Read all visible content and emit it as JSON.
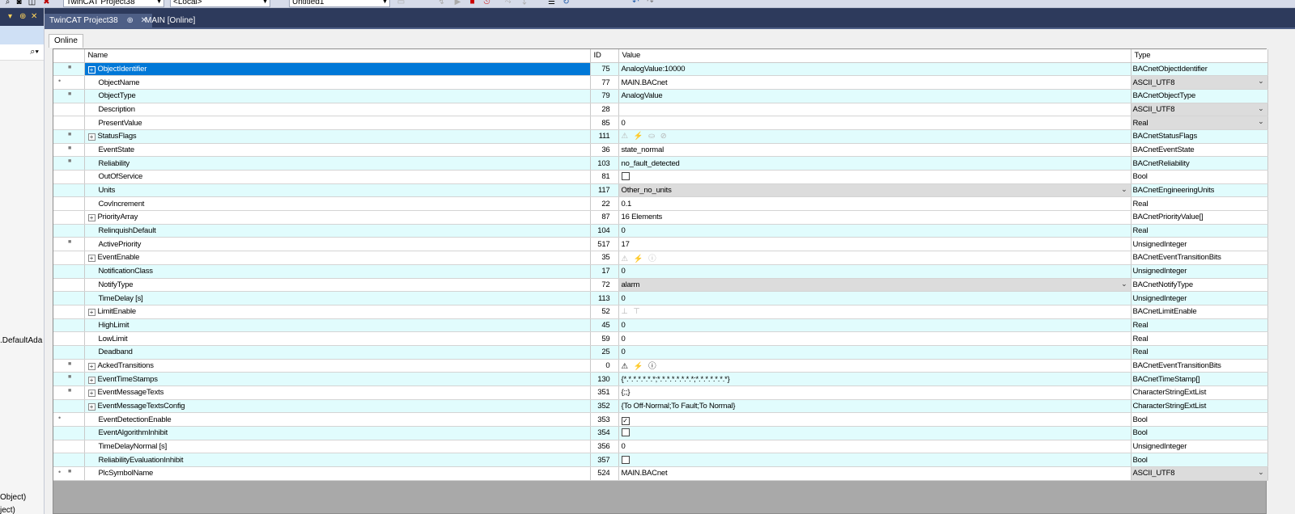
{
  "toolbar": {
    "project_combo": "TwinCAT Project38",
    "target_combo": "<Local>",
    "config_combo": "Untitled1"
  },
  "left_pane": {
    "texts": [
      ".DefaultAda",
      "Object)",
      "ject)"
    ]
  },
  "tabs": [
    {
      "label": "TwinCAT Project38",
      "active": true
    },
    {
      "label": "MAIN [Online]",
      "active": false
    }
  ],
  "inner_tab": "Online",
  "columns": {
    "name": "Name",
    "id": "ID",
    "value": "Value",
    "type": "Type"
  },
  "rows": [
    {
      "name": "ObjectIdentifier",
      "id": "75",
      "value": "AnalogValue:10000",
      "type": "BACnetObjectIdentifier",
      "icons": "lock",
      "expand": true,
      "selected": true
    },
    {
      "name": "ObjectName",
      "id": "77",
      "value": "MAIN.BACnet",
      "type": "ASCII_UTF8",
      "icons": "dot",
      "type_dropdown": true
    },
    {
      "name": "ObjectType",
      "id": "79",
      "value": "AnalogValue",
      "type": "BACnetObjectType",
      "icons": "lock"
    },
    {
      "name": "Description",
      "id": "28",
      "value": "",
      "type": "ASCII_UTF8",
      "type_dropdown": true
    },
    {
      "name": "PresentValue",
      "id": "85",
      "value": "0",
      "type": "Real",
      "type_dropdown": true
    },
    {
      "name": "StatusFlags",
      "id": "111",
      "value": "⚠ ⚡ ⛀ ⊘",
      "value_style": "faint",
      "type": "BACnetStatusFlags",
      "icons": "lock",
      "expand": true
    },
    {
      "name": "EventState",
      "id": "36",
      "value": "state_normal",
      "type": "BACnetEventState",
      "icons": "lock"
    },
    {
      "name": "Reliability",
      "id": "103",
      "value": "no_fault_detected",
      "type": "BACnetReliability",
      "icons": "lock"
    },
    {
      "name": "OutOfService",
      "id": "81",
      "value": "",
      "checkbox": false,
      "type": "Bool"
    },
    {
      "name": "Units",
      "id": "117",
      "value": "Other_no_units",
      "value_dropdown": true,
      "type": "BACnetEngineeringUnits"
    },
    {
      "name": "CovIncrement",
      "id": "22",
      "value": "0.1",
      "type": "Real"
    },
    {
      "name": "PriorityArray",
      "id": "87",
      "value": "16 Elements",
      "type": "BACnetPriorityValue[]",
      "expand": true
    },
    {
      "name": "RelinquishDefault",
      "id": "104",
      "value": "0",
      "type": "Real"
    },
    {
      "name": "ActivePriority",
      "id": "517",
      "value": "17",
      "type": "UnsignedInteger",
      "icons": "lock"
    },
    {
      "name": "EventEnable",
      "id": "35",
      "value": "⚠ ⚡ ⓘ",
      "value_style": "faint",
      "type": "BACnetEventTransitionBits",
      "expand": true
    },
    {
      "name": "NotificationClass",
      "id": "17",
      "value": "0",
      "type": "UnsignedInteger"
    },
    {
      "name": "NotifyType",
      "id": "72",
      "value": "alarm",
      "value_dropdown": true,
      "type": "BACnetNotifyType"
    },
    {
      "name": "TimeDelay [s]",
      "id": "113",
      "value": "0",
      "type": "UnsignedInteger"
    },
    {
      "name": "LimitEnable",
      "id": "52",
      "value": "⊥ ⊤",
      "value_style": "faint",
      "type": "BACnetLimitEnable",
      "expand": true
    },
    {
      "name": "HighLimit",
      "id": "45",
      "value": "0",
      "type": "Real"
    },
    {
      "name": "LowLimit",
      "id": "59",
      "value": "0",
      "type": "Real"
    },
    {
      "name": "Deadband",
      "id": "25",
      "value": "0",
      "type": "Real"
    },
    {
      "name": "AckedTransitions",
      "id": "0",
      "value": "⚠ ⚡ ⓘ",
      "value_style": "bold",
      "type": "BACnetEventTransitionBits",
      "icons": "lock",
      "expand": true
    },
    {
      "name": "EventTimeStamps",
      "id": "130",
      "value": "{*.*.*.*.*.*.*;*.*.*.*.*.*.*.*;*.*.*.*.*.*.*}",
      "type": "BACnetTimeStamp[]",
      "icons": "lock",
      "expand": true
    },
    {
      "name": "EventMessageTexts",
      "id": "351",
      "value": "{;;}",
      "type": "CharacterStringExtList",
      "icons": "lock",
      "expand": true
    },
    {
      "name": "EventMessageTextsConfig",
      "id": "352",
      "value": "{To Off-Normal;To Fault;To Normal}",
      "type": "CharacterStringExtList",
      "expand": true
    },
    {
      "name": "EventDetectionEnable",
      "id": "353",
      "value": "",
      "checkbox": true,
      "type": "Bool",
      "icons": "dot"
    },
    {
      "name": "EventAlgorithmInhibit",
      "id": "354",
      "value": "",
      "checkbox": false,
      "type": "Bool"
    },
    {
      "name": "TimeDelayNormal [s]",
      "id": "356",
      "value": "0",
      "type": "UnsignedInteger"
    },
    {
      "name": "ReliabilityEvaluationInhibit",
      "id": "357",
      "value": "",
      "checkbox": false,
      "type": "Bool"
    },
    {
      "name": "PlcSymbolName",
      "id": "524",
      "value": "MAIN.BACnet",
      "type": "ASCII_UTF8",
      "icons": "dot-lock",
      "type_dropdown": true
    }
  ],
  "row_bands": [
    1,
    0,
    1,
    0,
    2,
    1,
    0,
    1,
    0,
    1,
    0,
    2,
    1,
    0,
    2,
    1,
    0,
    1,
    2,
    1,
    0,
    1,
    2,
    1,
    0,
    1,
    0,
    1,
    0,
    1,
    2
  ]
}
